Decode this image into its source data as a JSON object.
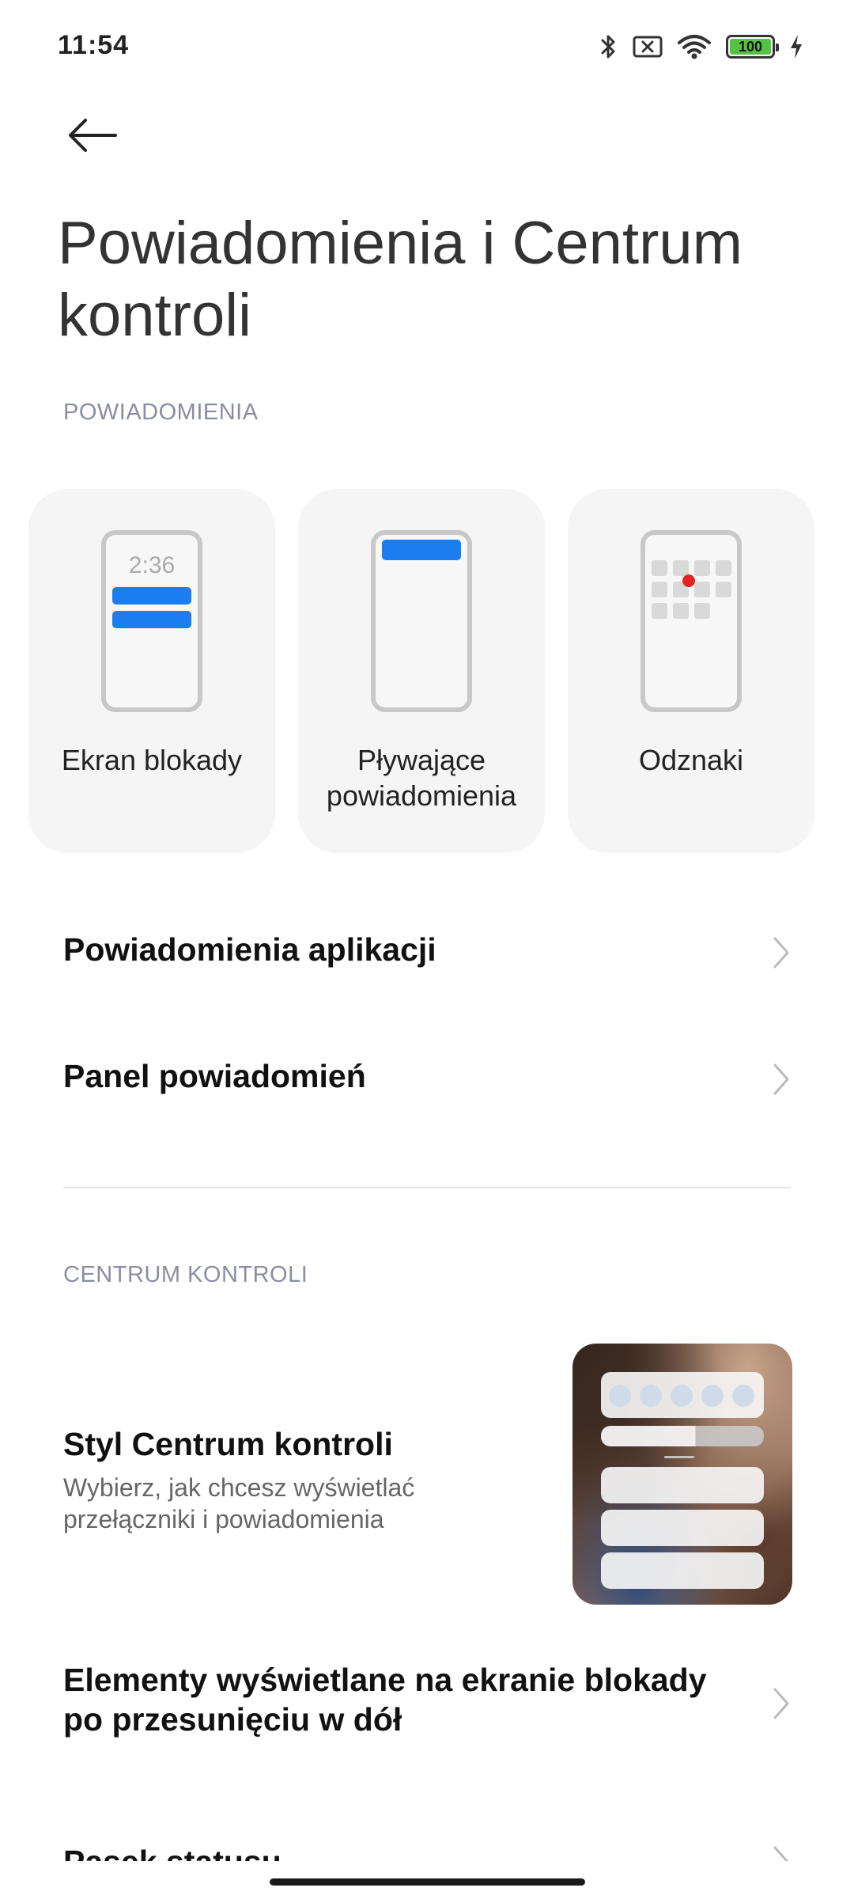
{
  "status_bar": {
    "time": "11:54",
    "battery_level": "100",
    "icons": [
      "bluetooth-icon",
      "no-sim-icon",
      "wifi-icon",
      "battery-icon",
      "charging-icon"
    ]
  },
  "header": {
    "title": "Powiadomienia i Centrum kontroli"
  },
  "notifications_section": {
    "header": "POWIADOMIENIA",
    "cards": [
      {
        "label": "Ekran blokady",
        "preview_time": "2:36"
      },
      {
        "label": "Pływające powiadomienia"
      },
      {
        "label": "Odznaki"
      }
    ],
    "rows": [
      {
        "title": "Powiadomienia aplikacji"
      },
      {
        "title": "Panel powiadomień"
      }
    ]
  },
  "control_center_section": {
    "header": "CENTRUM KONTROLI",
    "style_row": {
      "title": "Styl Centrum kontroli",
      "subtitle": "Wybierz, jak chcesz wyświetlać przełączniki i powiadomienia"
    },
    "rows": [
      {
        "title": "Elementy wyświetlane na ekranie blokady po przesunięciu w dół"
      },
      {
        "title": "Pasek statusu"
      }
    ]
  },
  "colors": {
    "accent_blue": "#1a7df0",
    "badge_red": "#e02424",
    "section_header": "#8a8ea3",
    "battery_green": "#56c243"
  }
}
